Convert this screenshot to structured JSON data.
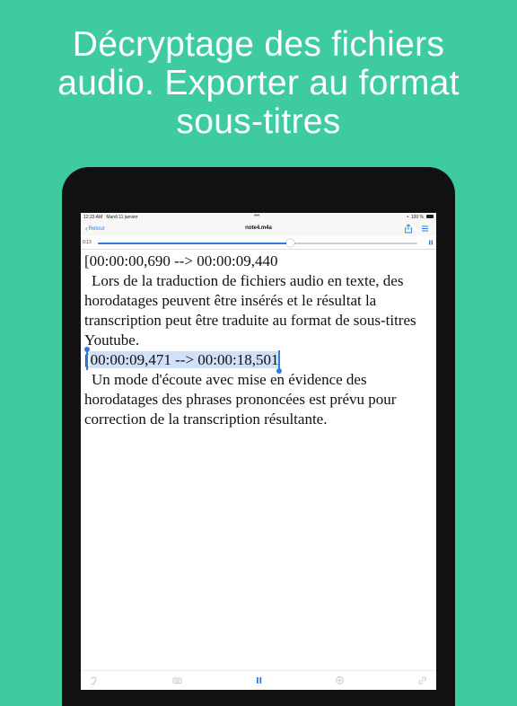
{
  "promo": {
    "headline_lines": [
      "Décryptage des fichiers",
      "audio. Exporter au format",
      "sous-titres"
    ]
  },
  "status_bar": {
    "time": "12:23 AM",
    "date": "Mardi 11 janvier",
    "battery": "100 %"
  },
  "nav": {
    "back_label": "Retour",
    "title": "note4.m4a",
    "share_icon": "share-icon",
    "menu_icon": "list-icon"
  },
  "player": {
    "elapsed": "0:13",
    "progress_fraction": 0.6,
    "pause_icon": "pause-icon"
  },
  "document": {
    "segments": [
      {
        "timestamp": "[00:00:00,690 --> 00:00:09,440",
        "text": "Lors de la traduction de fichiers audio en texte, des horodatages peuvent être insérés et le résultat la transcription peut être traduite au format de sous-titres Youtube."
      },
      {
        "timestamp_bracket": "[",
        "timestamp_selected": "00:00:09,471 --> 00:00:18,501",
        "text": "Un mode d'écoute avec mise en évidence des horodatages des phrases prononcées est prévu pour correction de la transcription résultante."
      }
    ]
  },
  "toolbar": {
    "icons": [
      "ear-icon",
      "keyboard-icon",
      "pause-icon",
      "plus-circle-icon",
      "link-icon"
    ]
  },
  "colors": {
    "background": "#3ecba2",
    "accent": "#2a7fe0",
    "selection": "#cfe0f7"
  }
}
